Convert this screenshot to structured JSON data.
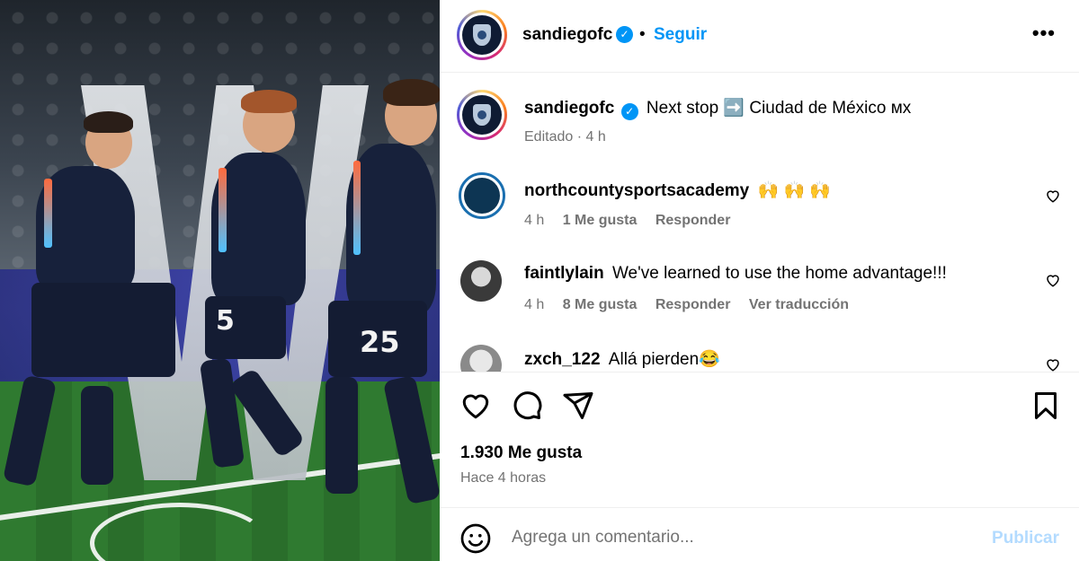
{
  "post": {
    "username": "sandiegofc",
    "follow_label": "Seguir",
    "separator": "•",
    "more_label": "•••"
  },
  "caption": {
    "username": "sandiegofc",
    "text": "Next stop ➡️ Ciudad de México ᴍx",
    "edited": "Editado · 4 h"
  },
  "comments": [
    {
      "username": "northcountysportsacademy",
      "text": "🙌 🙌 🙌",
      "time": "4 h",
      "likes": "1 Me gusta",
      "reply": "Responder",
      "translate": ""
    },
    {
      "username": "faintlylain",
      "text": "We've learned to use the home advantage!!!",
      "time": "4 h",
      "likes": "8 Me gusta",
      "reply": "Responder",
      "translate": "Ver traducción"
    },
    {
      "username": "zxch_122",
      "text": "Allá pierden😂",
      "time": "",
      "likes": "",
      "reply": "",
      "translate": ""
    }
  ],
  "stats": {
    "likes": "1.930 Me gusta",
    "time_ago": "Hace 4 horas"
  },
  "composer": {
    "placeholder": "Agrega un comentario...",
    "publish_label": "Publicar"
  },
  "photo": {
    "jersey_numbers": [
      "5",
      "25"
    ]
  },
  "colors": {
    "accent": "#0095f6",
    "muted_text": "#737373",
    "publish_disabled": "#b3dbff",
    "jersey": "#17213b"
  },
  "icons": [
    "verified-icon",
    "more-icon",
    "heart-icon",
    "comment-icon",
    "share-icon",
    "bookmark-icon",
    "emoji-icon"
  ]
}
